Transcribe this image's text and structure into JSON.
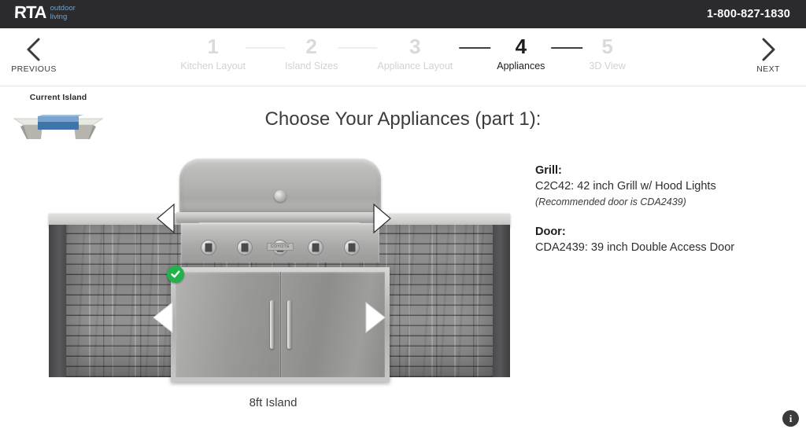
{
  "header": {
    "logo_main": "RTA",
    "logo_sub_line1": "outdoor",
    "logo_sub_line2": "living",
    "phone": "1-800-827-1830",
    "logo_accent_color": "#6fa3c7",
    "bar_color": "#2b2b2d"
  },
  "nav": {
    "previous_label": "PREVIOUS",
    "next_label": "NEXT",
    "prev_icon": "chevron-left-icon",
    "next_icon": "chevron-right-icon"
  },
  "steps": {
    "active_index": 3,
    "items": [
      {
        "num": "1",
        "label": "Kitchen Layout"
      },
      {
        "num": "2",
        "label": "Island Sizes"
      },
      {
        "num": "3",
        "label": "Appliance Layout"
      },
      {
        "num": "4",
        "label": "Appliances"
      },
      {
        "num": "5",
        "label": "3D View"
      }
    ]
  },
  "current_island": {
    "title": "Current Island",
    "highlight_color": "#3f74ab"
  },
  "main": {
    "page_title": "Choose Your Appliances (part 1):",
    "island_caption": "8ft Island"
  },
  "specs": {
    "grill_heading": "Grill:",
    "grill_value": "C2C42: 42 inch Grill w/ Hood Lights",
    "grill_note": "(Recommended door is CDA2439)",
    "door_heading": "Door:",
    "door_value": "CDA2439: 39 inch Double Access Door"
  },
  "island": {
    "check_badge_icon": "check-circle-icon",
    "check_badge_color": "#22b24c",
    "grill_prev_icon": "triangle-left-icon",
    "grill_next_icon": "triangle-right-icon",
    "door_prev_icon": "triangle-left-icon",
    "door_next_icon": "triangle-right-icon",
    "grill_brand_badge": "COYOTE"
  },
  "footer": {
    "info_icon": "info-icon",
    "info_label": "i"
  }
}
